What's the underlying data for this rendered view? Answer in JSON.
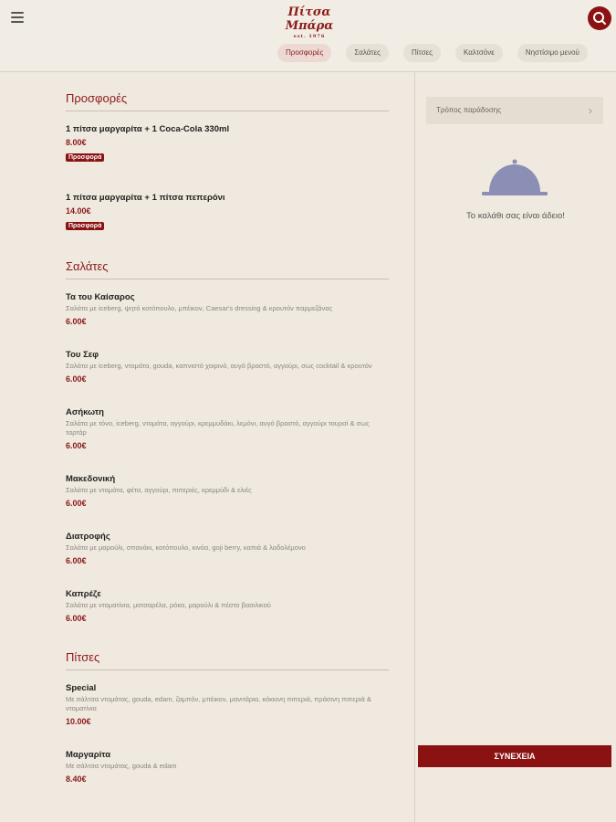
{
  "header": {
    "logo_text": "Πίτσα Μπάρα",
    "logo_sub": "est. 1976",
    "tabs": [
      {
        "label": "Προσφορές",
        "active": true
      },
      {
        "label": "Σαλάτες"
      },
      {
        "label": "Πίτσες"
      },
      {
        "label": "Καλτσόνε"
      },
      {
        "label": "Νηστίσιμο μενού"
      }
    ]
  },
  "menu": {
    "offers": {
      "title": "Προσφορές",
      "items": [
        {
          "name": "1 πίτσα μαργαρίτα + 1 Coca-Cola 330ml",
          "price": "8.00€",
          "badge": "Προσφορά"
        },
        {
          "name": "1 πίτσα μαργαρίτα + 1 πίτσα πεπερόνι",
          "price": "14.00€",
          "badge": "Προσφορά"
        }
      ]
    },
    "salads": {
      "title": "Σαλάτες",
      "items": [
        {
          "name": "Τα του Καίσαρος",
          "desc": "Σαλάτα με iceberg, ψητό κοτόπουλο, μπέικον, Caesar's dressing & κρουτόν παρμεζάνας",
          "price": "6.00€"
        },
        {
          "name": "Του Σεφ",
          "desc": "Σαλάτα με iceberg, ντομάτα, gouda, καπνιστό χοιρινό, αυγό βραστό, αγγούρι, σως cocktail & κρουτόν",
          "price": "6.00€"
        },
        {
          "name": "Ασήκωτη",
          "desc": "Σαλάτα με τόνο, iceberg, ντομάτα, αγγούρι, κρεμμυδάκι, λεμόνι, αυγό βραστό, αγγούρι τουρσί & σως ταρτάρ",
          "price": "6.00€"
        },
        {
          "name": "Μακεδονική",
          "desc": "Σαλάτα με ντομάτα, φέτα, αγγούρι, πιπεριές, κρεμμύδι & ελιές",
          "price": "6.00€"
        },
        {
          "name": "Διατροφής",
          "desc": "Σαλάτα με μαρούλι, σπανάκι, κοτόπουλο, κινόα, goji berry, καπιά & λαδολέμονο",
          "price": "6.00€"
        },
        {
          "name": "Καπρέζε",
          "desc": "Σαλάτα με ντοματίνια, μοτσαρέλα, ρόκα, μαρούλι & πέστο βασιλικού",
          "price": "6.00€"
        }
      ]
    },
    "pizzas": {
      "title": "Πίτσες",
      "items": [
        {
          "name": "Special",
          "desc": "Με σάλτσα ντομάτας, gouda, edam, ζαμπόν, μπέικον, μανιτάρια, κόκκινη πιπεριά, πράσινη πιπεριά & ντοματίνια",
          "price": "10.00€"
        },
        {
          "name": "Μαργαρίτα",
          "desc": "Με σάλτσα ντομάτας, gouda & edam",
          "price": "8.40€"
        }
      ]
    }
  },
  "cart": {
    "delivery_label": "Τρόπος παράδοσης",
    "empty_text": "Το καλάθι σας είναι άδειο!",
    "continue_label": "ΣΥΝΕΧΕΙΑ"
  },
  "colors": {
    "accent": "#8b1212",
    "background": "#efe9df",
    "cloche": "#8c8fb5"
  }
}
